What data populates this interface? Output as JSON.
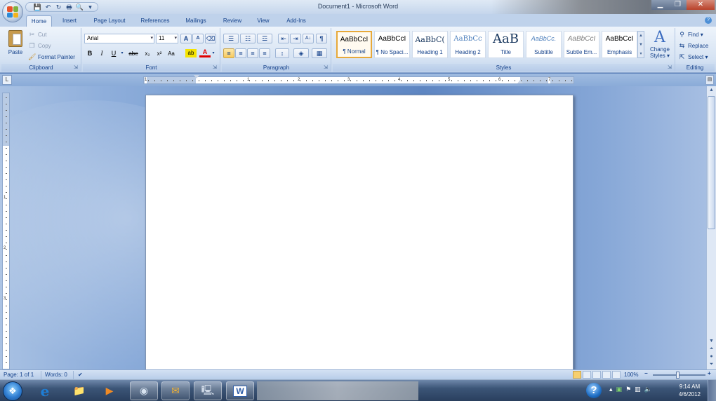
{
  "window": {
    "title": "Document1 - Microsoft Word",
    "minimize": "▁",
    "restore": "❐",
    "close": "✕"
  },
  "qat": {
    "save": "💾",
    "undo": "↶",
    "redo": "↻",
    "quick_print": "🖶",
    "print_preview": "🔍",
    "more": "▾"
  },
  "tabs": [
    "Home",
    "Insert",
    "Page Layout",
    "References",
    "Mailings",
    "Review",
    "View",
    "Add-Ins"
  ],
  "clipboard": {
    "label": "Clipboard",
    "paste": "Paste",
    "cut": "Cut",
    "copy": "Copy",
    "format_painter": "Format Painter"
  },
  "font": {
    "label": "Font",
    "name": "Arial",
    "size": "11",
    "grow": "A",
    "shrink": "A",
    "clear": "⌫",
    "bold": "B",
    "italic": "I",
    "underline": "U",
    "strike": "abe",
    "subscript": "x₂",
    "superscript": "x²",
    "change_case": "Aa",
    "highlight": "ab",
    "font_color": "A"
  },
  "paragraph": {
    "label": "Paragraph",
    "bullets": "☰",
    "numbering": "☷",
    "multilevel": "☲",
    "decrease_indent": "⇤",
    "increase_indent": "⇥",
    "sort": "A↓",
    "show_marks": "¶",
    "align_left": "≡",
    "center": "≡",
    "align_right": "≡",
    "justify": "≡",
    "line_spacing": "↕",
    "shading": "◈",
    "borders": "▦"
  },
  "styles": {
    "label": "Styles",
    "items": [
      {
        "sample": "AaBbCcI",
        "name": "¶ Normal"
      },
      {
        "sample": "AaBbCcI",
        "name": "¶ No Spaci..."
      },
      {
        "sample": "AaBbC(",
        "name": "Heading 1"
      },
      {
        "sample": "AaBbCc",
        "name": "Heading 2"
      },
      {
        "sample": "AaB",
        "name": "Title"
      },
      {
        "sample": "AaBbCc.",
        "name": "Subtitle"
      },
      {
        "sample": "AaBbCcI",
        "name": "Subtle Em..."
      },
      {
        "sample": "AaBbCcI",
        "name": "Emphasis"
      }
    ],
    "change_styles_icon": "A",
    "change_styles_line1": "Change",
    "change_styles_line2": "Styles ▾"
  },
  "editing": {
    "label": "Editing",
    "find": "Find ▾",
    "replace": "Replace",
    "select": "Select ▾"
  },
  "ruler": {
    "tab_selector": "L",
    "numbers": [
      "1",
      "1",
      "2",
      "3",
      "4",
      "5",
      "6",
      "7"
    ],
    "vnumbers": [
      "1",
      "2",
      "3"
    ]
  },
  "status": {
    "page": "Page: 1 of 1",
    "words": "Words: 0",
    "proofing": "✔",
    "zoom": "100%",
    "zoom_out": "−",
    "zoom_in": "+"
  },
  "taskbar": {
    "start": "❖",
    "apps": [
      {
        "name": "internet-explorer",
        "glyph": "e",
        "color": "#1e7ed6"
      },
      {
        "name": "file-explorer",
        "glyph": "📁",
        "color": "#e3c26b"
      },
      {
        "name": "media-player",
        "glyph": "▶",
        "color": "#f08a24"
      },
      {
        "name": "network-app",
        "glyph": "◉",
        "color": "#d7e3f0"
      },
      {
        "name": "outlook",
        "glyph": "✉",
        "color": "#f2b233"
      },
      {
        "name": "remote-desktop",
        "glyph": "🖳",
        "color": "#cfd9e6"
      },
      {
        "name": "microsoft-word",
        "glyph": "W",
        "color": "#2f5ea8"
      }
    ],
    "help": "?",
    "tray_arrow": "▴",
    "time": "9:14 AM",
    "date": "4/6/2012"
  },
  "colors": {
    "accent": "#15428b",
    "ribbon": "#d6e3f3",
    "highlight_yellow": "#f5e400",
    "font_red": "#e00000"
  }
}
